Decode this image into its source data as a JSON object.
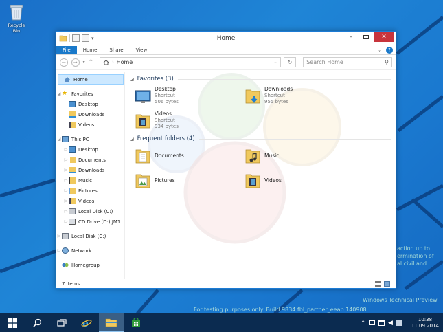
{
  "desktop": {
    "recycle_bin_label": "Recycle Bin",
    "watermark_right": [
      "action up to",
      "ermination of",
      "al civil and"
    ],
    "watermark_preview": "Windows Technical Preview",
    "watermark_build": "For testing purposes only. Build 9834.fbl_partner_eeap.140908"
  },
  "window": {
    "title": "Home",
    "ribbon_tabs": [
      "File",
      "Home",
      "Share",
      "View"
    ],
    "address": {
      "path_label": "Home",
      "search_placeholder": "Search Home"
    },
    "nav": {
      "home": "Home",
      "favorites": "Favorites",
      "fav_items": [
        "Desktop",
        "Downloads",
        "Videos"
      ],
      "this_pc": "This PC",
      "pc_items": [
        "Desktop",
        "Documents",
        "Downloads",
        "Music",
        "Pictures",
        "Videos",
        "Local Disk (C:)",
        "CD Drive (D:) JM1"
      ],
      "local_disk": "Local Disk (C:)",
      "network": "Network",
      "homegroup": "Homegroup"
    },
    "favorites_header": "Favorites (3)",
    "favorites": [
      {
        "name": "Desktop",
        "type": "Shortcut",
        "size": "506 bytes",
        "icon": "desktop-icon"
      },
      {
        "name": "Downloads",
        "type": "Shortcut",
        "size": "955 bytes",
        "icon": "downloads-folder-icon"
      },
      {
        "name": "Videos",
        "type": "Shortcut",
        "size": "934 bytes",
        "icon": "videos-folder-icon"
      }
    ],
    "frequent_header": "Frequent folders (4)",
    "frequent": [
      {
        "name": "Documents",
        "icon": "documents-folder-icon"
      },
      {
        "name": "Music",
        "icon": "music-folder-icon"
      },
      {
        "name": "Pictures",
        "icon": "pictures-folder-icon"
      },
      {
        "name": "Videos",
        "icon": "videos-folder-icon"
      }
    ],
    "status": "7 items"
  },
  "taskbar": {
    "time": "10:38",
    "date": "11.09.2014"
  },
  "colors": {
    "accent": "#1979ca",
    "close": "#c7343c",
    "taskbar": "#0b2b50",
    "selection": "#cce8ff"
  }
}
